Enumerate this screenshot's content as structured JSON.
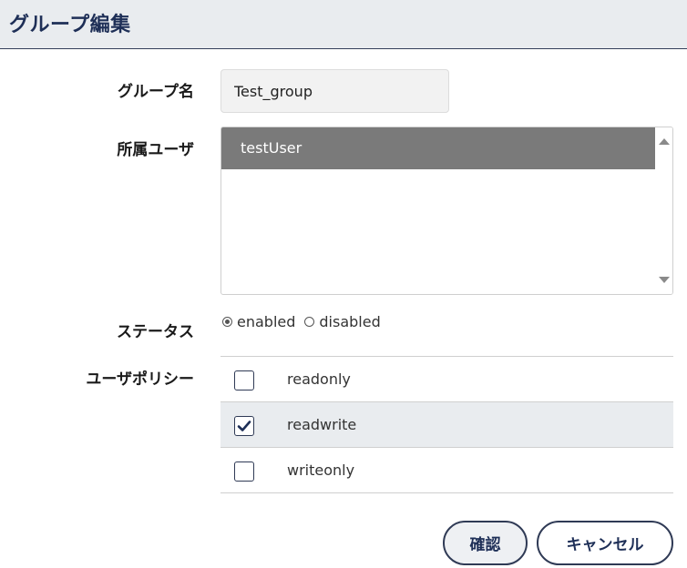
{
  "header": {
    "title": "グループ編集"
  },
  "form": {
    "group_name": {
      "label": "グループ名",
      "value": "Test_group"
    },
    "members": {
      "label": "所属ユーザ",
      "options": [
        "testUser"
      ],
      "selected": "testUser"
    },
    "status": {
      "label": "ステータス",
      "options": [
        {
          "label": "enabled",
          "checked": true
        },
        {
          "label": "disabled",
          "checked": false
        }
      ]
    },
    "policy": {
      "label": "ユーザポリシー",
      "items": [
        {
          "label": "readonly",
          "checked": false
        },
        {
          "label": "readwrite",
          "checked": true
        },
        {
          "label": "writeonly",
          "checked": false
        }
      ]
    }
  },
  "buttons": {
    "confirm_label": "確認",
    "cancel_label": "キャンセル"
  },
  "colors": {
    "header_bg": "#e9ecef",
    "accent": "#1e2f57",
    "selected_option_bg": "#7a7a7a",
    "active_row_bg": "#e9ecef"
  }
}
